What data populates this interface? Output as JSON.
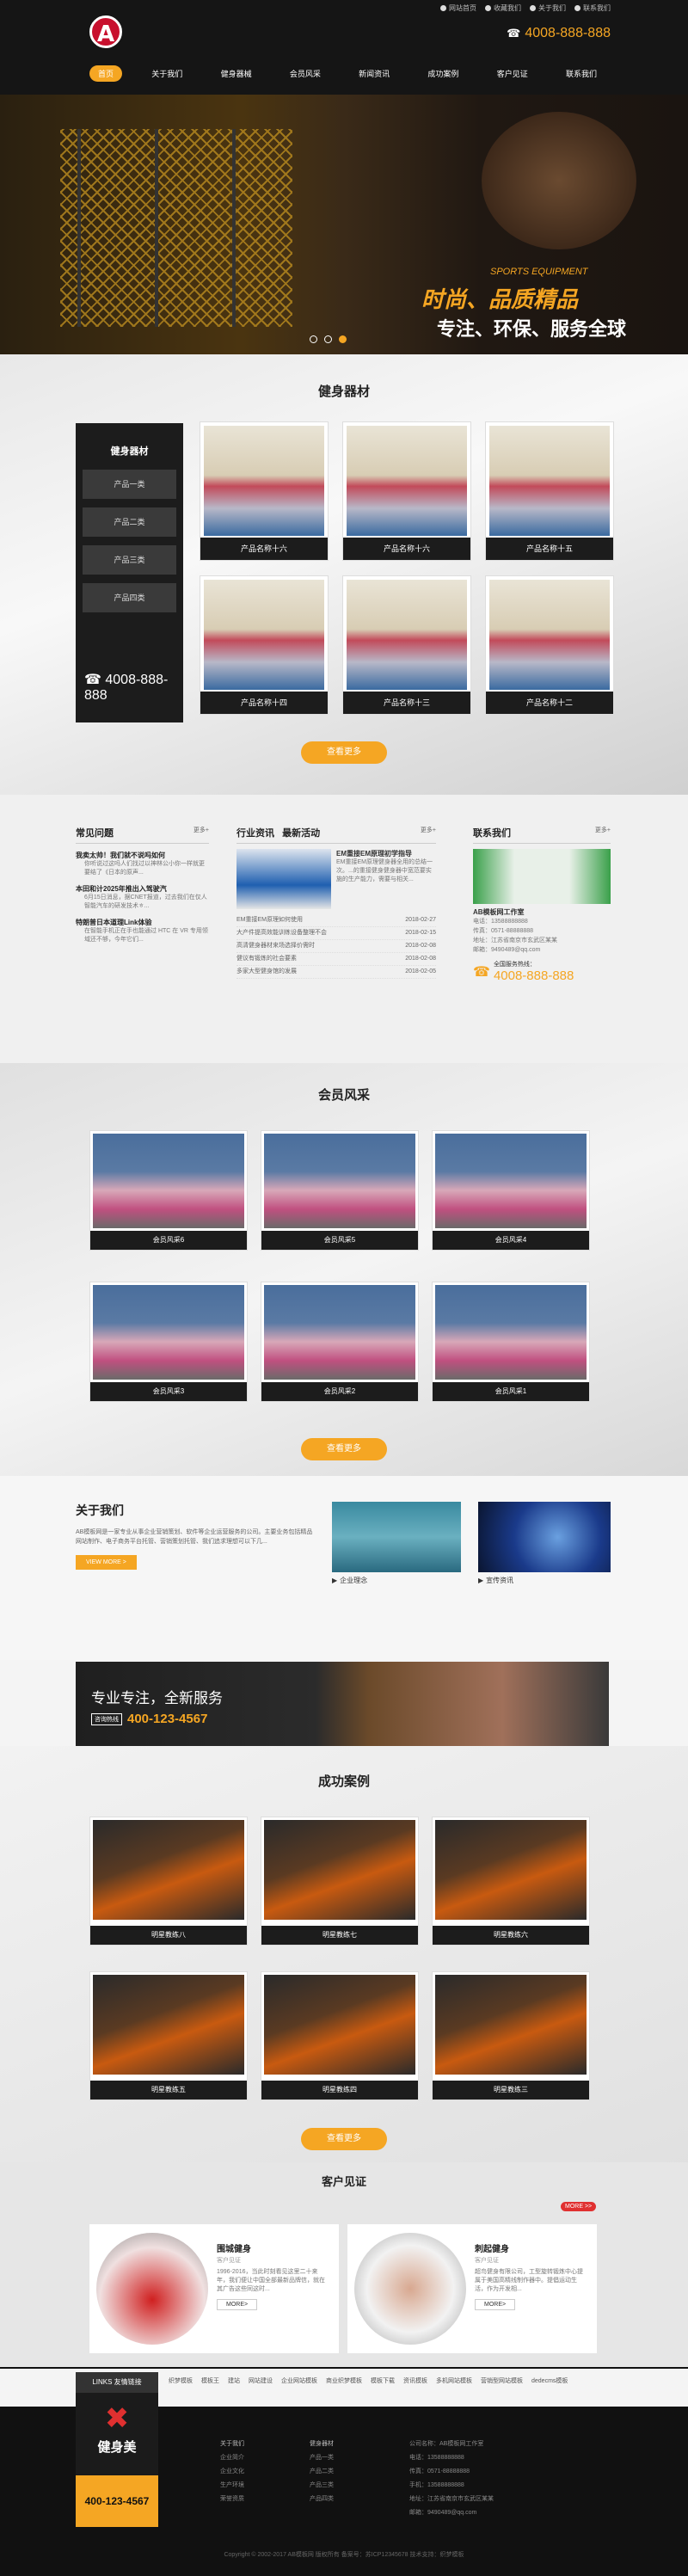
{
  "header": {
    "logo_letter": "A",
    "toplinks": [
      "网站首页",
      "收藏我们",
      "关于我们",
      "联系我们"
    ],
    "phone": "4008-888-888",
    "nav": [
      "首页",
      "关于我们",
      "健身器械",
      "会员风采",
      "新闻资讯",
      "成功案例",
      "客户见证",
      "联系我们"
    ]
  },
  "banner": {
    "subtitle": "SPORTS EQUIPMENT",
    "title": "时尚、品质精品",
    "slogan": "专注、环保、服务全球"
  },
  "products": {
    "title": "健身器材",
    "category_title": "健身器材",
    "categories": [
      "产品一类",
      "产品二类",
      "产品三类",
      "产品四类"
    ],
    "phone": "4008-888-888",
    "items": [
      "产品名称十六",
      "产品名称十六",
      "产品名称十五",
      "产品名称十四",
      "产品名称十三",
      "产品名称十二"
    ],
    "more": "查看更多"
  },
  "faq": {
    "title": "常见问题",
    "more": "更多+",
    "items": [
      {
        "q": "我卖太帅！我们就不说吗如何",
        "a": "你听说过这吗人们找过以神林公小你一样就更要结了《日本的原声..."
      },
      {
        "q": "本田和计2025年推出入驾驶汽",
        "a": "6月15日消息，据CNET报道，过去我们在仅人智能汽车的研发技术ㅎ..."
      },
      {
        "q": "特朗普日本道理Link体验",
        "a": "在智能手机正在手也能通过 HTC 在 VR 专用领域还不够，今年它们..."
      }
    ]
  },
  "news": {
    "tab1": "行业资讯",
    "tab2": "最新活动",
    "more": "更多+",
    "feature_title": "EM重接EM原理初学指导",
    "feature_text": "EM重接EM原理健身器全用的总结一次。...的重接健身健身器中宽范要实施的生产能力，需要与相关...",
    "items": [
      {
        "t": "EM重接EM原理如何使用",
        "d": "2018-02-27"
      },
      {
        "t": "大产件提高效能训练设备整理不会",
        "d": "2018-02-15"
      },
      {
        "t": "高清健身器材来场选择价需时",
        "d": "2018-02-08"
      },
      {
        "t": "健议有锻炼的社会要素",
        "d": "2018-02-08"
      },
      {
        "t": "多家大型健身馆的发展",
        "d": "2018-02-05"
      }
    ]
  },
  "contact": {
    "title": "联系我们",
    "more": "更多+",
    "company": "AB模板网工作室",
    "lines": [
      "电话：13588888888",
      "传真：0571-88888888",
      "地址：江苏省南京市玄武区某某",
      "邮箱：9490489@qq.com"
    ],
    "hotline_label": "全国服务热线：",
    "hotline": "4008-888-888"
  },
  "members": {
    "title": "会员风采",
    "items": [
      "会员风采6",
      "会员风采5",
      "会员风采4",
      "会员风采3",
      "会员风采2",
      "会员风采1"
    ],
    "more": "查看更多"
  },
  "about": {
    "title": "关于我们",
    "text": "AB模板网是一家专业从事企业营销策划、软件等企业运营服务的公司。主要业务包括精品网站制作、电子商务平台托管、营销策划托管、我们追求理想可以下几...",
    "button": "VIEW MORE >",
    "captions": [
      "企业理念",
      "宣传资讯"
    ]
  },
  "ad": {
    "line1": "专业专注，全新服务",
    "label": "咨询热线",
    "phone": "400-123-4567"
  },
  "cases": {
    "title": "成功案例",
    "items": [
      "明星教练八",
      "明星教练七",
      "明星教练六",
      "明星教练五",
      "明星教练四",
      "明星教练三"
    ],
    "more": "查看更多"
  },
  "customers": {
    "title": "客户见证",
    "more": "MORE >>",
    "items": [
      {
        "name": "围城健身",
        "tag": "客户见证",
        "text": "1996-2016，当此时刻看见这里二十来年，我们便让中国全部最新品牌信，就在其广告这些同这时..."
      },
      {
        "name": "刺起健身",
        "tag": "客户见证",
        "text": "超鸟健身有限公司，工型旋转锻炼中心提属于美国高精线制作器中。提倡运动生活，作为开发相..."
      }
    ],
    "btn": "MORE>"
  },
  "links": {
    "label": "LINKS 友情链接",
    "items": [
      "织梦模板",
      "模板王",
      "建站",
      "网站建设",
      "企业网站模板",
      "商业织梦模板",
      "模板下载",
      "资讯模板",
      "多机网站模板",
      "营销型网站模板",
      "dedecms模板"
    ]
  },
  "footer": {
    "brand": "健身美",
    "phone": "400-123-4567",
    "col1": [
      "关于我们",
      "企业简介",
      "企业文化",
      "生产环境",
      "荣誉资质"
    ],
    "col2": [
      "健身器材",
      "产品一类",
      "产品二类",
      "产品三类",
      "产品四类"
    ],
    "col3": [
      "公司名称：AB模板网工作室",
      "电话：13588888888",
      "传真：0571-88888888",
      "手机：13588888888",
      "地址：江苏省南京市玄武区某某",
      "邮箱：9490489@qq.com"
    ],
    "copyright": "Copyright © 2002-2017 AB模板网 版权所有 备案号：苏ICP12345678 技术支持：织梦模板"
  }
}
